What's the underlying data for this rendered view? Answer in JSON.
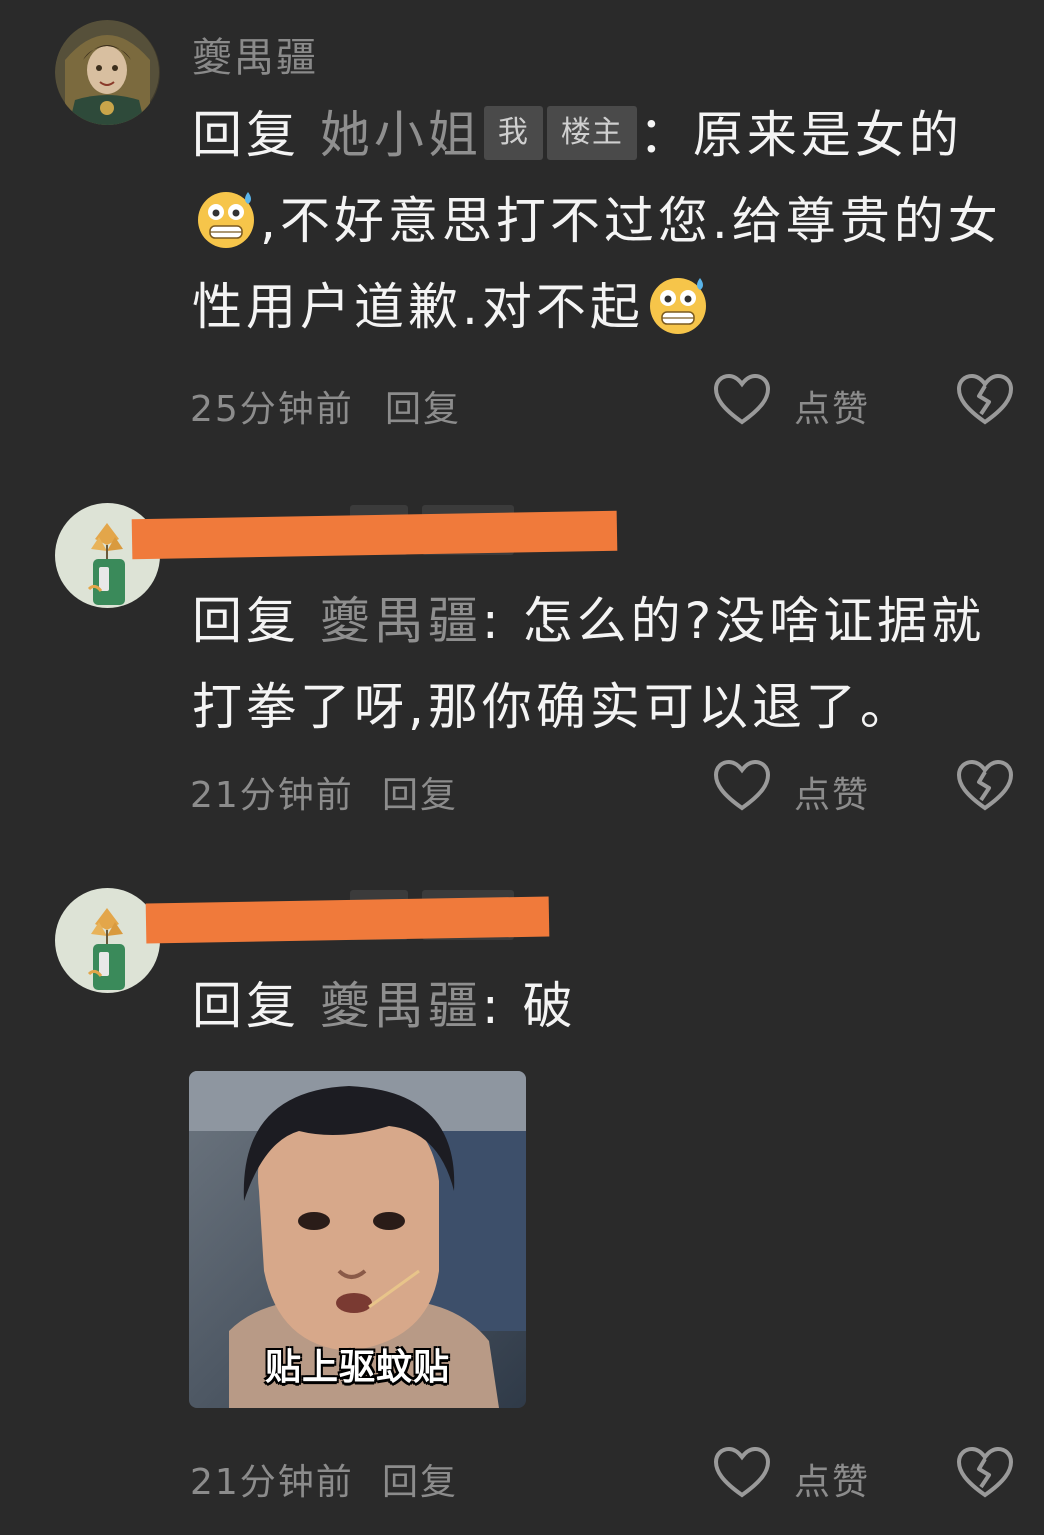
{
  "comments": [
    {
      "username": "夔禺疆",
      "reply_keyword": "回复",
      "mention": "她小姐",
      "tags": [
        "我",
        "楼主"
      ],
      "text_part1": "：原来是女的",
      "text_part2": ",不好意思打不过您.给尊贵的女性用户道歉.对不起",
      "emoji": "grimacing-sweat-emoji",
      "time": "25分钟前",
      "reply_label": "回复",
      "like_label": "点赞"
    },
    {
      "reply_keyword": "回复",
      "mention": "夔禺疆",
      "text": ": 怎么的?没啥证据就打拳了呀,那你确实可以退了。",
      "time": "21分钟前",
      "reply_label": "回复",
      "like_label": "点赞"
    },
    {
      "reply_keyword": "回复",
      "mention": "夔禺疆",
      "text": ": 破",
      "sticker_caption": "贴上驱蚊贴",
      "time": "21分钟前",
      "reply_label": "回复",
      "like_label": "点赞"
    }
  ],
  "icons": {
    "like": "heart-outline-icon",
    "dislike": "broken-heart-icon"
  },
  "colors": {
    "background": "#2a2a2a",
    "redaction": "#f07a3b",
    "tag_bg": "#4a4a4a",
    "muted_text": "#8c8c8c"
  }
}
